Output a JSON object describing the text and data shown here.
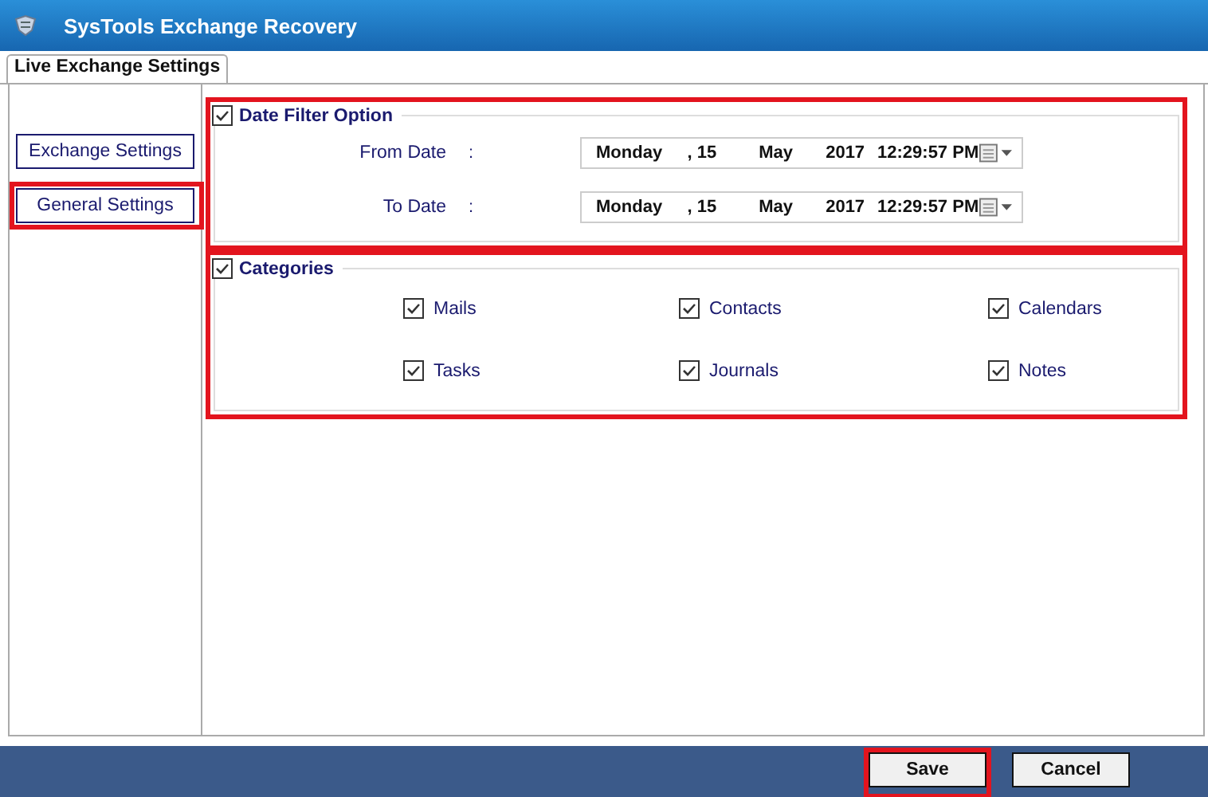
{
  "window": {
    "title": "SysTools  Exchange Recovery"
  },
  "tabs": [
    {
      "label": "Live Exchange Settings",
      "selected": true
    }
  ],
  "sidebar": {
    "items": [
      {
        "label": "Exchange Settings",
        "highlighted": false
      },
      {
        "label": "General Settings",
        "highlighted": true
      }
    ]
  },
  "date_filter": {
    "label": "Date Filter Option",
    "checked": true,
    "highlighted": true,
    "fields": [
      {
        "label": "From Date",
        "colon": ":",
        "weekday": "Monday",
        "day": ", 15",
        "month": "May",
        "year": "2017",
        "time": "12:29:57 PM"
      },
      {
        "label": "To Date",
        "colon": ":",
        "weekday": "Monday",
        "day": ", 15",
        "month": "May",
        "year": "2017",
        "time": "12:29:57 PM"
      }
    ]
  },
  "categories": {
    "label": "Categories",
    "checked": true,
    "highlighted": true,
    "items": [
      {
        "label": "Mails",
        "checked": true
      },
      {
        "label": "Contacts",
        "checked": true
      },
      {
        "label": "Calendars",
        "checked": true
      },
      {
        "label": "Tasks",
        "checked": true
      },
      {
        "label": "Journals",
        "checked": true
      },
      {
        "label": "Notes",
        "checked": true
      }
    ]
  },
  "buttons": [
    {
      "label": "Save",
      "highlighted": true
    },
    {
      "label": "Cancel",
      "highlighted": false
    }
  ]
}
